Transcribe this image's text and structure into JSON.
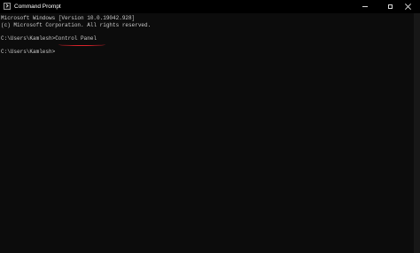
{
  "window": {
    "title": "Command Prompt",
    "controls": {
      "minimize": "minimize",
      "maximize": "maximize",
      "close": "close"
    }
  },
  "console": {
    "lines": [
      "Microsoft Windows [Version 10.0.19042.928]",
      "(c) Microsoft Corporation. All rights reserved.",
      "C:\\Users\\Kamlesh>Control Panel",
      "C:\\Users\\Kamlesh>"
    ],
    "highlight_color": "#d9232b"
  },
  "icons": {
    "app": "command-prompt-icon",
    "minimize": "minimize-icon",
    "maximize": "maximize-icon",
    "close": "close-icon"
  },
  "colors": {
    "background": "#0c0c0c",
    "text": "#cccccc",
    "titlebar": "#000000"
  }
}
